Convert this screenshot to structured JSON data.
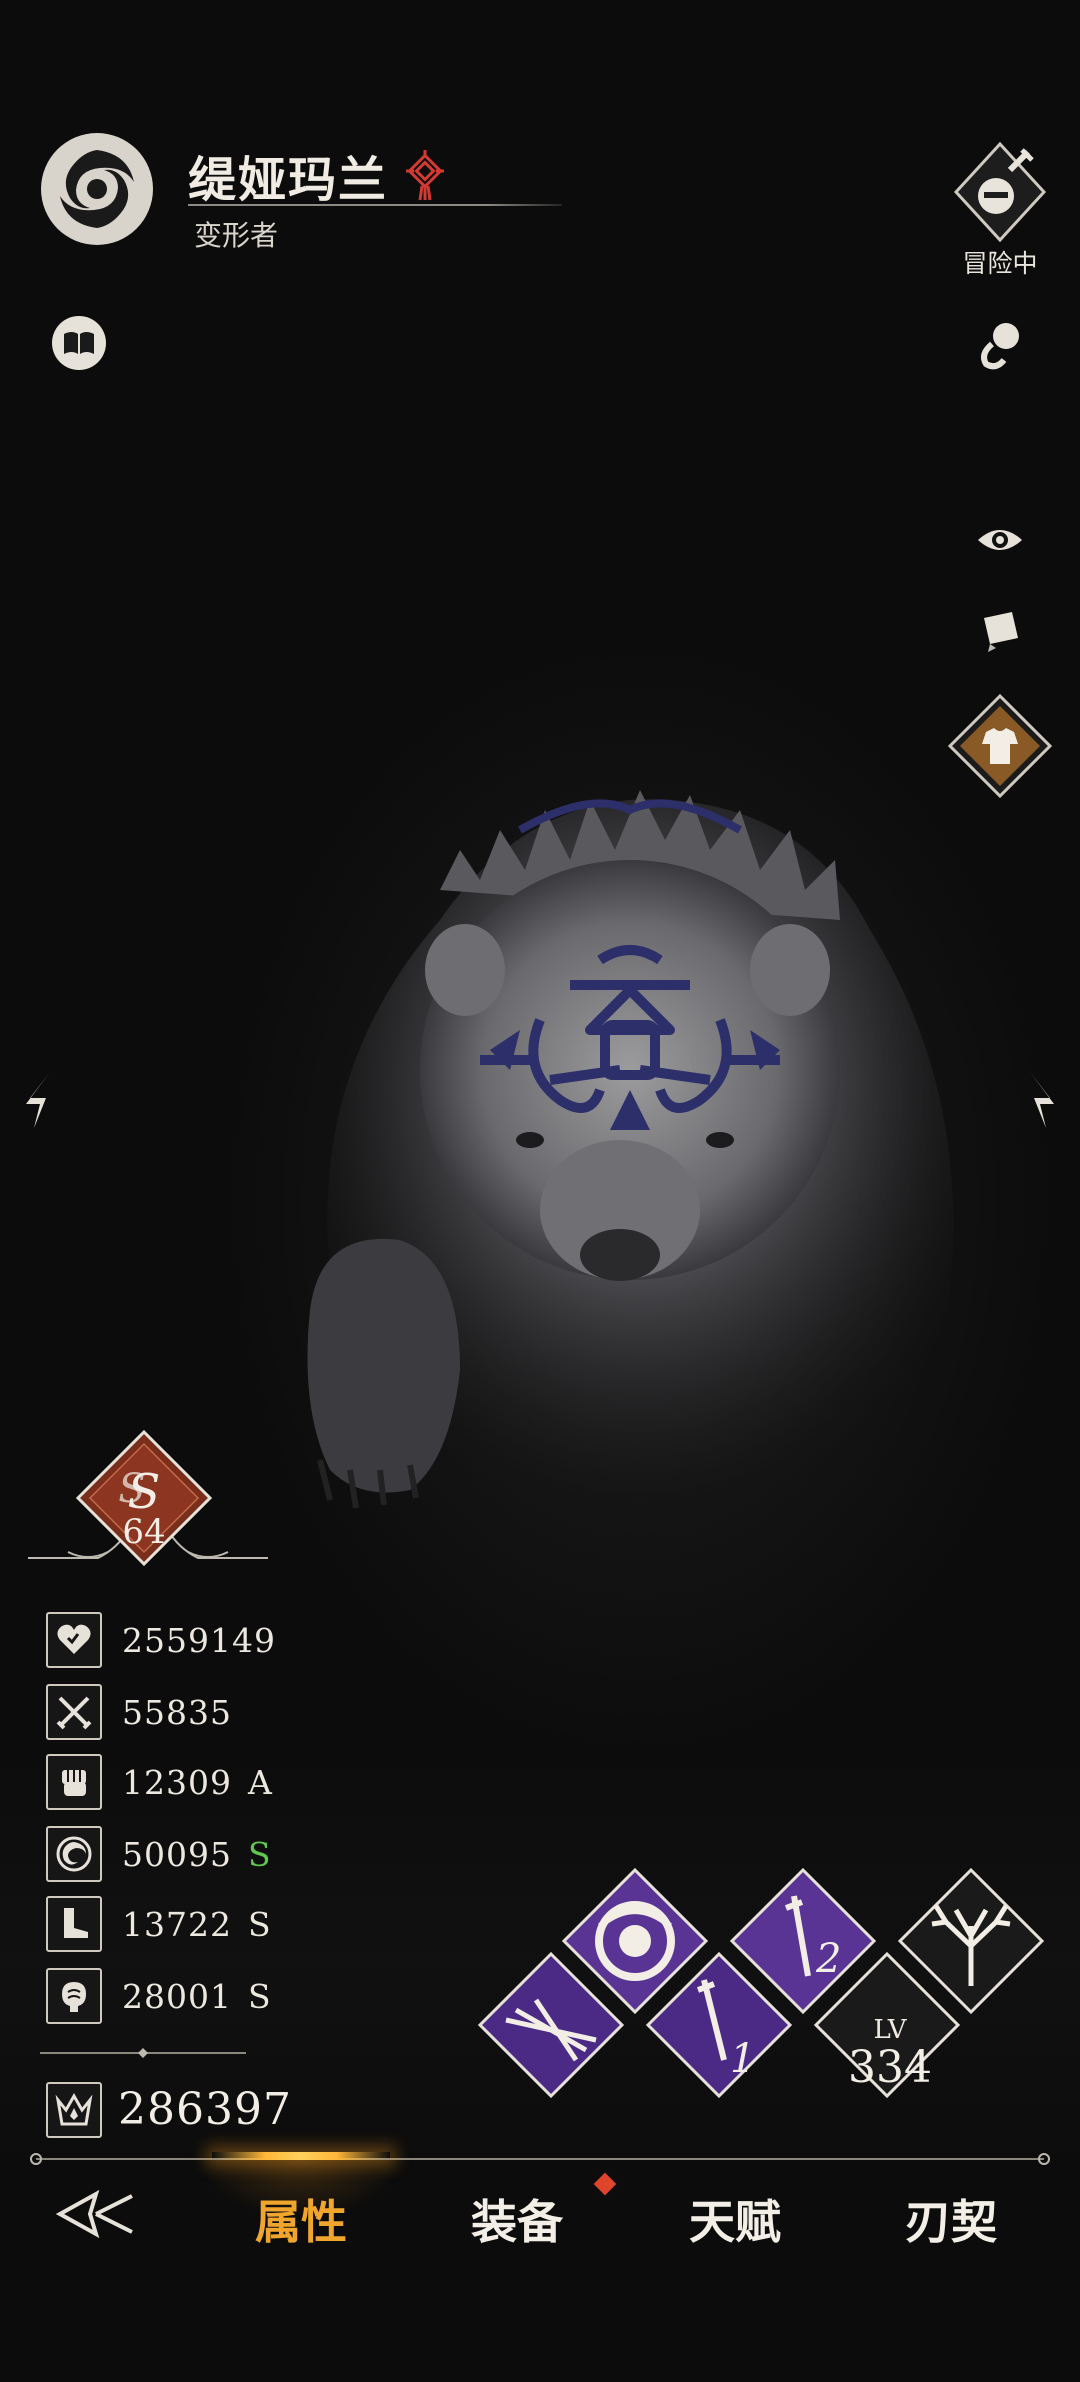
{
  "header": {
    "character_name": "缇娅玛兰",
    "character_class": "变形者",
    "adventure_status": "冒险中"
  },
  "rank": {
    "level": "64"
  },
  "stats": [
    {
      "icon": "heart-icon",
      "value": "2559149",
      "grade": ""
    },
    {
      "icon": "crossed-swords-icon",
      "value": "55835",
      "grade": ""
    },
    {
      "icon": "fist-icon",
      "value": "12309",
      "grade": "A"
    },
    {
      "icon": "swirl-icon",
      "value": "50095",
      "grade": "S",
      "grade_color": "#5fc64f"
    },
    {
      "icon": "boot-icon",
      "value": "13722",
      "grade": "S"
    },
    {
      "icon": "brain-icon",
      "value": "28001",
      "grade": "S"
    }
  ],
  "combat_power": "286397",
  "skills": {
    "slot1_badge": "1",
    "slot2_badge": "2",
    "lv_label": "LV",
    "lv_value": "334"
  },
  "nav": {
    "tabs": [
      "属性",
      "装备",
      "天赋",
      "刃契"
    ],
    "active_index": 0,
    "active_color": "#f0a52d",
    "equip_notification": true
  },
  "icons": [
    "class-emblem-icon",
    "chinese-knot-icon",
    "adventure-helmet-icon",
    "book-icon",
    "pet-icon",
    "eye-icon",
    "paper-icon",
    "outfit-icon",
    "arrow-left-icon",
    "arrow-right-icon",
    "combat-power-icon",
    "back-icon"
  ]
}
